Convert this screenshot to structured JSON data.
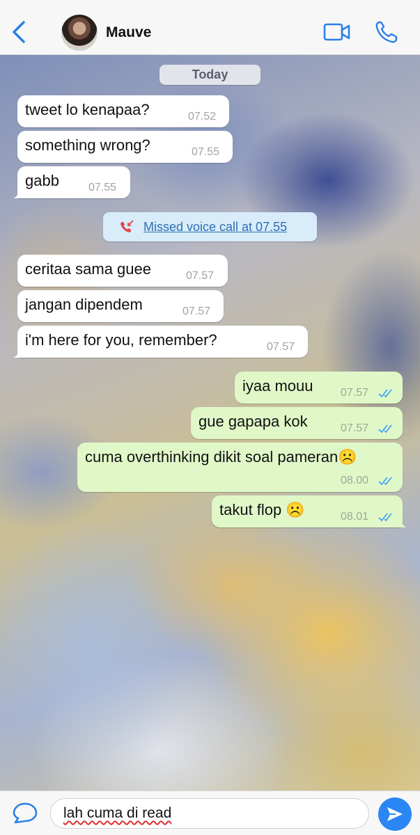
{
  "header": {
    "contact_name": "Mauve",
    "back_icon": "chevron-left-icon",
    "video_icon": "video-camera-icon",
    "call_icon": "phone-icon",
    "accent_color": "#2a7fe8"
  },
  "chat": {
    "date_label": "Today",
    "messages_in_1": [
      {
        "text": "tweet lo kenapaa?",
        "time": "07.52"
      },
      {
        "text": "something wrong?",
        "time": "07.55"
      },
      {
        "text": "gabb",
        "time": "07.55"
      }
    ],
    "missed_call": {
      "text": "Missed voice call at 07.55",
      "icon": "missed-call-icon"
    },
    "messages_in_2": [
      {
        "text": "ceritaa sama guee",
        "time": "07.57"
      },
      {
        "text": "jangan dipendem",
        "time": "07.57"
      },
      {
        "text": "i'm here for you, remember?",
        "time": "07.57"
      }
    ],
    "messages_out": [
      {
        "text": "iyaa mouu",
        "time": "07.57"
      },
      {
        "text": "gue gapapa kok",
        "time": "07.57"
      },
      {
        "text": "cuma overthinking dikit soal pameran☹️",
        "time": "08.00"
      },
      {
        "text": "takut flop ☹️",
        "time": "08.01"
      }
    ],
    "incoming_bubble_color": "#ffffff",
    "outgoing_bubble_color": "#e0f8c8",
    "read_tick_color": "#4aa3f0"
  },
  "composer": {
    "input_value": "lah cuma di read",
    "compose_icon": "speech-bubble-icon",
    "send_icon": "send-arrow-icon"
  }
}
